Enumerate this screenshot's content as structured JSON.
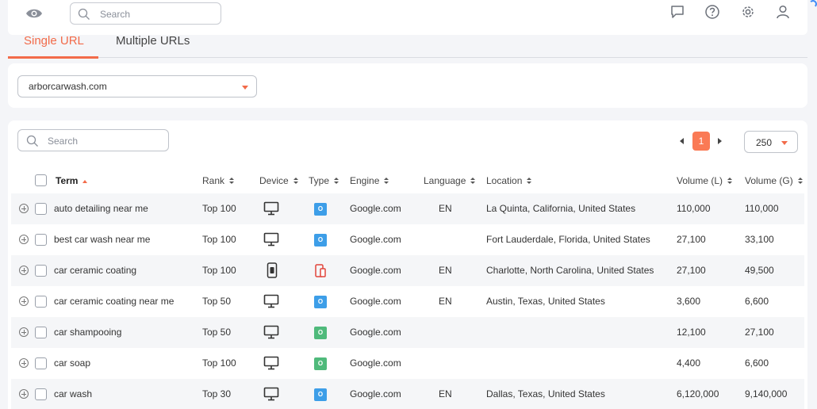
{
  "header": {
    "search_placeholder": "Search"
  },
  "tabs": [
    {
      "label": "Single URL",
      "active": true
    },
    {
      "label": "Multiple URLs",
      "active": false
    }
  ],
  "url_selector": {
    "value": "arborcarwash.com"
  },
  "table_toolbar": {
    "search_placeholder": "Search",
    "current_page": "1",
    "per_page": "250"
  },
  "columns": {
    "term": "Term",
    "rank": "Rank",
    "device": "Device",
    "type": "Type",
    "engine": "Engine",
    "language": "Language",
    "location": "Location",
    "volume_l": "Volume (L)",
    "volume_g": "Volume (G)"
  },
  "rows": [
    {
      "term": "auto detailing near me",
      "rank": "Top 100",
      "device": "desktop-icon",
      "type": "local-icon",
      "engine": "Google.com",
      "language": "EN",
      "location": "La Quinta, California, United States",
      "volume_l": "110,000",
      "volume_g": "110,000"
    },
    {
      "term": "best car wash near me",
      "rank": "Top 100",
      "device": "desktop-icon",
      "type": "local-icon",
      "engine": "Google.com",
      "language": "",
      "location": "Fort Lauderdale, Florida, United States",
      "volume_l": "27,100",
      "volume_g": "33,100"
    },
    {
      "term": "car ceramic coating",
      "rank": "Top 100",
      "device": "mobile-icon",
      "type": "mobile-type-icon",
      "engine": "Google.com",
      "language": "EN",
      "location": "Charlotte, North Carolina, United States",
      "volume_l": "27,100",
      "volume_g": "49,500"
    },
    {
      "term": "car ceramic coating near me",
      "rank": "Top 50",
      "device": "desktop-icon",
      "type": "local-icon",
      "engine": "Google.com",
      "language": "EN",
      "location": "Austin, Texas, United States",
      "volume_l": "3,600",
      "volume_g": "6,600"
    },
    {
      "term": "car shampooing",
      "rank": "Top 50",
      "device": "desktop-icon",
      "type": "organic-icon",
      "engine": "Google.com",
      "language": "",
      "location": "",
      "volume_l": "12,100",
      "volume_g": "27,100"
    },
    {
      "term": "car soap",
      "rank": "Top 100",
      "device": "desktop-icon",
      "type": "organic-icon",
      "engine": "Google.com",
      "language": "",
      "location": "",
      "volume_l": "4,400",
      "volume_g": "6,600"
    },
    {
      "term": "car wash",
      "rank": "Top 30",
      "device": "desktop-icon",
      "type": "local-icon",
      "engine": "Google.com",
      "language": "EN",
      "location": "Dallas, Texas, United States",
      "volume_l": "6,120,000",
      "volume_g": "9,140,000"
    }
  ],
  "colors": {
    "accent": "#f26b4a",
    "local_badge": "#3d9ee8",
    "organic_badge": "#4fba7b"
  }
}
